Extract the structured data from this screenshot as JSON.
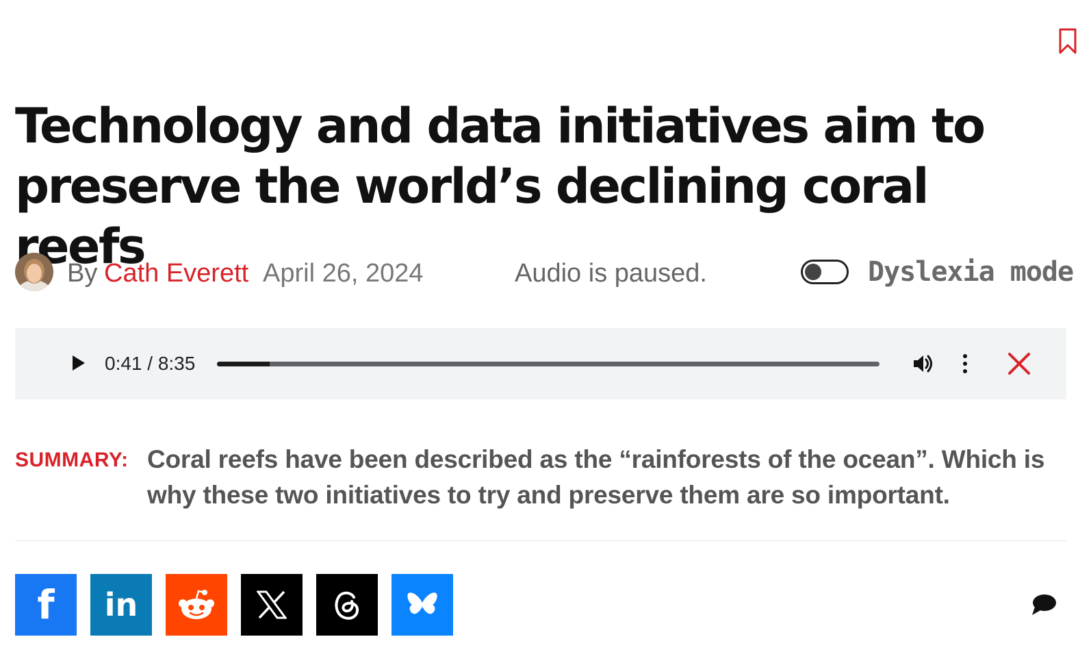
{
  "article": {
    "title": "Technology and data initiatives aim to preserve the world’s declining coral reefs",
    "byline_prefix": "By",
    "author": "Cath Everett",
    "date": "April 26, 2024",
    "audio_status": "Audio is paused.",
    "dyslexia_label": "Dyslexia mode",
    "dyslexia_mode_on": false
  },
  "player": {
    "time": "0:41 / 8:35",
    "progress_fraction": 0.0796
  },
  "summary": {
    "label": "SUMMARY:",
    "text": "Coral reefs have been described as the “rainforests of the ocean”. Which is why these two initiatives to try and preserve them are so important."
  },
  "share": {
    "buttons": [
      {
        "name": "facebook",
        "glyph": "f",
        "color": "#1877f2"
      },
      {
        "name": "linkedin",
        "glyph": "in",
        "color": "#0a7bb5"
      },
      {
        "name": "reddit",
        "glyph": "",
        "color": "#ff4500"
      },
      {
        "name": "x",
        "glyph": "",
        "color": "#000000"
      },
      {
        "name": "threads",
        "glyph": "",
        "color": "#000000"
      },
      {
        "name": "bluesky",
        "glyph": "",
        "color": "#0a85ff"
      }
    ]
  },
  "colors": {
    "accent_red": "#d8232a"
  }
}
